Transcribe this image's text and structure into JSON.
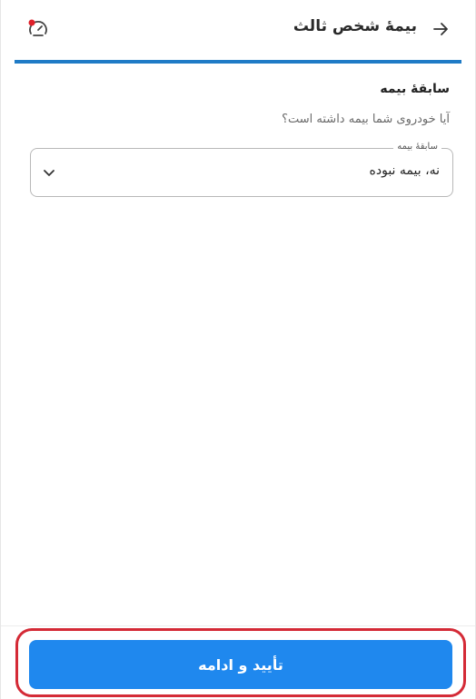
{
  "header": {
    "title": "بیمهٔ شخص ثالث",
    "back_icon": "arrow-right-icon",
    "support_icon": "speedometer-icon"
  },
  "progress": {
    "fraction": 1.0,
    "color": "#1f7bc6"
  },
  "section": {
    "title": "سابقهٔ بیمه",
    "question": "آیا خودروی شما بیمه داشته است؟"
  },
  "insurance_history_select": {
    "label": "سابقهٔ بیمه",
    "selected_value": "نه، بیمه نبوده"
  },
  "footer": {
    "confirm_label": "تأیید و ادامه",
    "button_color": "#1f88ee",
    "highlight_color": "#d42a36"
  }
}
